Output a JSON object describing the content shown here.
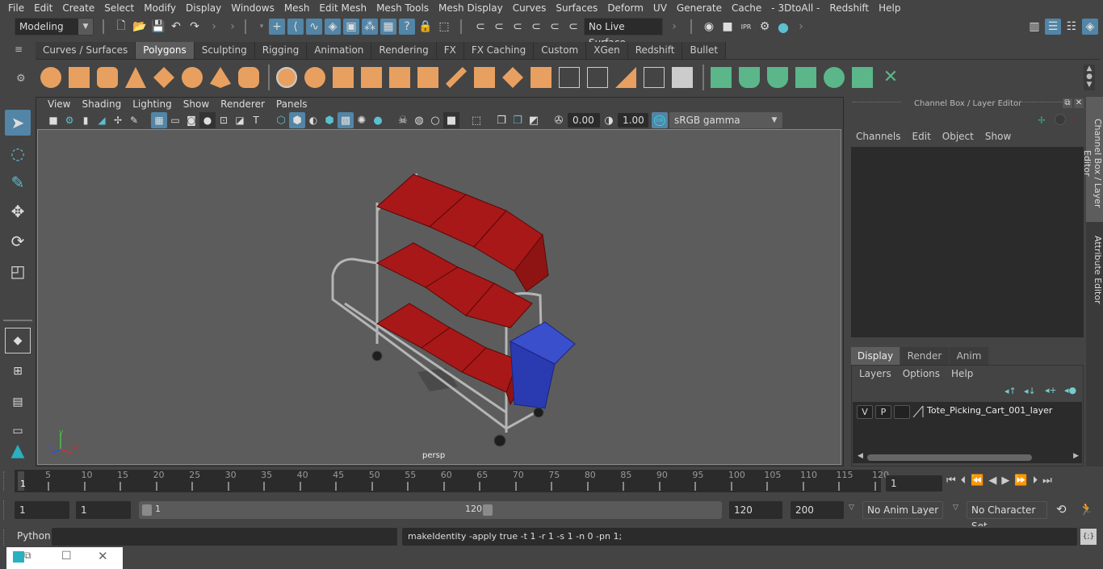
{
  "menubar": {
    "items": [
      "File",
      "Edit",
      "Create",
      "Select",
      "Modify",
      "Display",
      "Windows",
      "Mesh",
      "Edit Mesh",
      "Mesh Tools",
      "Mesh Display",
      "Curves",
      "Surfaces",
      "Deform",
      "UV",
      "Generate",
      "Cache",
      "- 3DtoAll -",
      "Redshift",
      "Help"
    ]
  },
  "statusline": {
    "mode_menu": "Modeling",
    "live_surface": "No Live Surface",
    "icons": [
      "new-scene-icon",
      "open-scene-icon",
      "save-scene-icon",
      "undo-icon",
      "redo-icon",
      "select-hierarchy-icon",
      "select-object-icon",
      "select-component-icon",
      "snap-grid-icon",
      "snap-curve-icon",
      "snap-point-icon",
      "snap-view-icon",
      "snap-surface-icon",
      "lock-icon",
      "render-view-icon",
      "ipr-render-icon",
      "render-settings-icon",
      "hypershade-icon"
    ]
  },
  "shelf": {
    "tabs": [
      "Curves / Surfaces",
      "Polygons",
      "Sculpting",
      "Rigging",
      "Animation",
      "Rendering",
      "FX",
      "FX Caching",
      "Custom",
      "XGen",
      "Redshift",
      "Bullet"
    ],
    "active_tab": "Polygons",
    "accent_orange": "#e8a060",
    "accent_green": "#5bb68a"
  },
  "panel": {
    "menu": [
      "View",
      "Shading",
      "Lighting",
      "Show",
      "Renderer",
      "Panels"
    ],
    "exposure": "0.00",
    "gamma": "1.00",
    "color_mgmt_toggle": "ON",
    "color_space": "sRGB gamma",
    "camera_label": "persp",
    "axis": {
      "x": "x",
      "y": "y",
      "z": "z"
    }
  },
  "toolbox": {
    "tools": [
      "select-tool",
      "lasso-tool",
      "paint-select-tool",
      "move-tool",
      "rotate-tool",
      "scale-tool"
    ]
  },
  "channel_box": {
    "title": "Channel Box / Layer Editor",
    "menu": [
      "Channels",
      "Edit",
      "Object",
      "Show"
    ],
    "layer_tabs": [
      "Display",
      "Render",
      "Anim"
    ],
    "active_layer_tab": "Display",
    "layer_menu": [
      "Layers",
      "Options",
      "Help"
    ],
    "layers": [
      {
        "visible": "V",
        "playback": "P",
        "name": "Tote_Picking_Cart_001_layer"
      }
    ]
  },
  "side_tabs": [
    "Channel Box / Layer Editor",
    "Attribute Editor"
  ],
  "timeline": {
    "ticks": [
      5,
      10,
      15,
      20,
      25,
      30,
      35,
      40,
      45,
      50,
      55,
      60,
      65,
      70,
      75,
      80,
      85,
      90,
      95,
      100,
      105,
      110,
      115,
      120
    ],
    "current_frame_marker": "1",
    "current_frame": "1"
  },
  "range": {
    "start_time": "1",
    "playback_start": "1",
    "slider_start": "1",
    "slider_end": "120",
    "playback_end": "120",
    "end_time": "200",
    "anim_layer": "No Anim Layer",
    "character_set": "No Character Set"
  },
  "command_line": {
    "language": "Python",
    "input": "",
    "result": "makeIdentity -apply true -t 1 -r 1 -s 1 -n 0 -pn 1;"
  }
}
